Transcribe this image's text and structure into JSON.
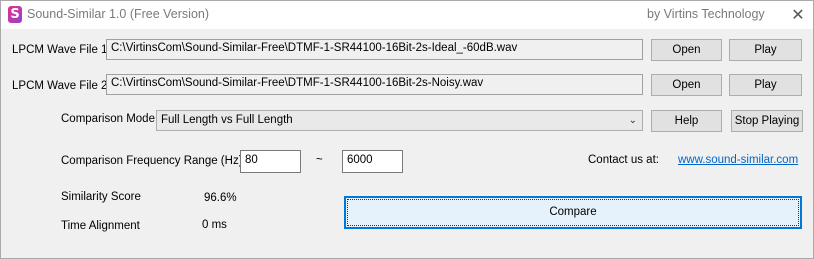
{
  "titlebar": {
    "title": "Sound-Similar 1.0  (Free Version)",
    "company": "by Virtins Technology",
    "app_icon_glyph": "S",
    "close_glyph": "✕"
  },
  "files": [
    {
      "label": "LPCM Wave File 1",
      "path": "C:\\VirtinsCom\\Sound-Similar-Free\\DTMF-1-SR44100-16Bit-2s-Ideal_-60dB.wav",
      "open_label": "Open",
      "play_label": "Play"
    },
    {
      "label": "LPCM Wave File 2",
      "path": "C:\\VirtinsCom\\Sound-Similar-Free\\DTMF-1-SR44100-16Bit-2s-Noisy.wav",
      "open_label": "Open",
      "play_label": "Play"
    }
  ],
  "comparison": {
    "mode_label": "Comparison Mode",
    "mode_value": "Full Length vs Full Length",
    "help_label": "Help",
    "stop_label": "Stop Playing",
    "range_label": "Comparison Frequency Range (Hz)",
    "range_from": "80",
    "range_sep": "~",
    "range_to": "6000",
    "contact_label": "Contact us at:",
    "contact_link": "www.sound-similar.com"
  },
  "results": {
    "score_label": "Similarity Score",
    "score_value": "96.6%",
    "alignment_label": "Time Alignment",
    "alignment_value": "0 ms"
  },
  "compare_label": "Compare"
}
